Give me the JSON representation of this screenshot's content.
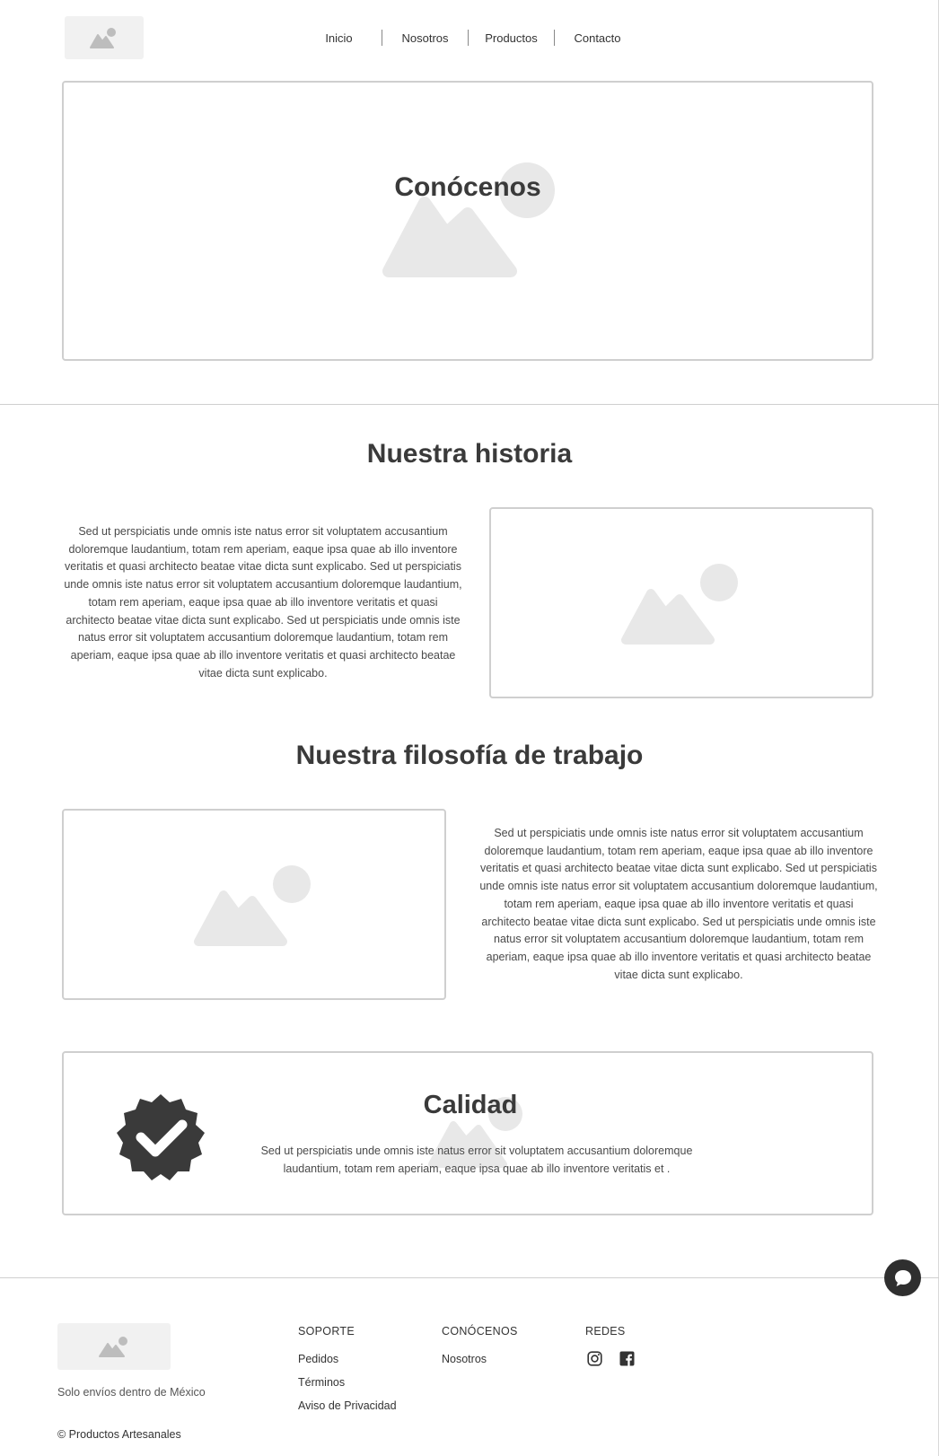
{
  "nav": {
    "items": [
      "Inicio",
      "Nosotros",
      "Productos",
      "Contacto"
    ]
  },
  "hero": {
    "title": "Conócenos"
  },
  "historia": {
    "title": "Nuestra historia",
    "text": "Sed ut perspiciatis unde omnis iste natus error sit voluptatem accusantium doloremque laudantium, totam rem aperiam, eaque ipsa quae ab illo inventore veritatis et quasi architecto beatae vitae dicta sunt explicabo.  Sed ut perspiciatis unde omnis iste natus error sit voluptatem accusantium doloremque laudantium, totam rem aperiam, eaque ipsa quae ab illo inventore veritatis et quasi architecto beatae vitae dicta sunt explicabo.  Sed ut perspiciatis unde omnis iste natus error sit voluptatem accusantium doloremque laudantium, totam rem aperiam, eaque ipsa quae ab illo inventore veritatis et quasi architecto beatae vitae dicta sunt explicabo."
  },
  "filosofia": {
    "title": "Nuestra filosofía de trabajo",
    "text": "Sed ut perspiciatis unde omnis iste natus error sit voluptatem accusantium doloremque laudantium, totam rem aperiam, eaque ipsa quae ab illo inventore veritatis et quasi architecto beatae vitae dicta sunt explicabo.  Sed ut perspiciatis unde omnis iste natus error sit voluptatem accusantium doloremque laudantium, totam rem aperiam, eaque ipsa quae ab illo inventore veritatis et quasi architecto beatae vitae dicta sunt explicabo.  Sed ut perspiciatis unde omnis iste natus error sit voluptatem accusantium doloremque laudantium, totam rem aperiam, eaque ipsa quae ab illo inventore veritatis et quasi architecto beatae vitae dicta sunt explicabo."
  },
  "calidad": {
    "title": "Calidad",
    "text": "Sed ut perspiciatis unde omnis iste natus error sit voluptatem accusantium doloremque laudantium, totam rem aperiam, eaque ipsa quae ab illo inventore veritatis et ."
  },
  "footer": {
    "tagline": "Solo envíos dentro de México",
    "copyright": "© Productos Artesanales",
    "soporte": {
      "heading": "SOPORTE",
      "links": [
        "Pedidos",
        "Términos",
        "Aviso de Privacidad"
      ]
    },
    "conocenos": {
      "heading": "CONÓCENOS",
      "links": [
        "Nosotros"
      ]
    },
    "redes": {
      "heading": "REDES",
      "icons": [
        "instagram-icon",
        "facebook-icon"
      ]
    }
  },
  "icons": {
    "placeholder": "image-placeholder-icon",
    "badge": "verified-badge-icon",
    "chat": "chat-bubble-icon"
  },
  "colors": {
    "placeholder_fill": "#e8e8e8",
    "border": "#cfcfcf",
    "dark": "#2f2f2f"
  }
}
